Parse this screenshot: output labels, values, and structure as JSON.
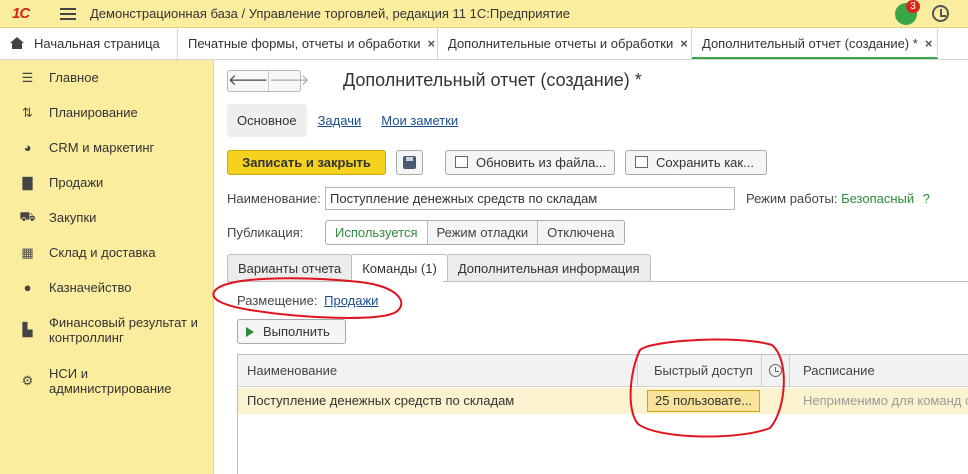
{
  "titlebar": {
    "logo": "1С",
    "title": "Демонстрационная база / Управление торговлей, редакция 11 1С:Предприятие",
    "notification_count": "3"
  },
  "tabs": [
    {
      "label": "Начальная страница"
    },
    {
      "label": "Печатные формы, отчеты и обработки",
      "close": "×"
    },
    {
      "label": "Дополнительные отчеты и обработки",
      "close": "×"
    },
    {
      "label": "Дополнительный отчет (создание) *",
      "close": "×"
    }
  ],
  "sidebar": {
    "items": [
      {
        "label": "Главное",
        "icon": "menu-icon"
      },
      {
        "label": "Планирование",
        "icon": "planning-icon"
      },
      {
        "label": "CRM и маркетинг",
        "icon": "pie-chart-icon"
      },
      {
        "label": "Продажи",
        "icon": "shopping-bag-icon"
      },
      {
        "label": "Закупки",
        "icon": "cart-icon"
      },
      {
        "label": "Склад и доставка",
        "icon": "warehouse-icon"
      },
      {
        "label": "Казначейство",
        "icon": "coin-icon"
      },
      {
        "label": "Финансовый результат и контроллинг",
        "icon": "bar-chart-icon"
      },
      {
        "label": "НСИ и администрирование",
        "icon": "gear-icon"
      }
    ]
  },
  "form": {
    "title": "Дополнительный отчет (создание) *",
    "subtabs": {
      "main": "Основное",
      "tasks": "Задачи",
      "notes": "Мои заметки"
    },
    "buttons": {
      "save_close": "Записать и закрыть",
      "update_from_file": "Обновить из файла...",
      "save_as": "Сохранить как..."
    },
    "name_label": "Наименование:",
    "name_value": "Поступление денежных средств по складам",
    "mode_label": "Режим работы:",
    "mode_value": "Безопасный",
    "mode_help": "?",
    "publication_label": "Публикация:",
    "publication_options": [
      "Используется",
      "Режим отладки",
      "Отключена"
    ],
    "publication_selected": "Используется",
    "form_tabs": [
      "Варианты отчета",
      "Команды (1)",
      "Дополнительная информация"
    ],
    "placement_label": "Размещение:",
    "placement_value": "Продажи",
    "run_button": "Выполнить",
    "grid": {
      "columns": [
        "Наименование",
        "Быстрый доступ",
        "Расписание"
      ],
      "rows": [
        {
          "name": "Поступление денежных средств по складам",
          "quick_access": "25 пользовате...",
          "schedule": "Неприменимо для команд с"
        }
      ]
    }
  },
  "colors": {
    "titlebar_bg": "#fbed9e",
    "sidebar_bg": "#fbed9e",
    "primary_button": "#f4d21d",
    "accent_green": "#2e8b3a",
    "annotation_red": "#e0141e"
  }
}
